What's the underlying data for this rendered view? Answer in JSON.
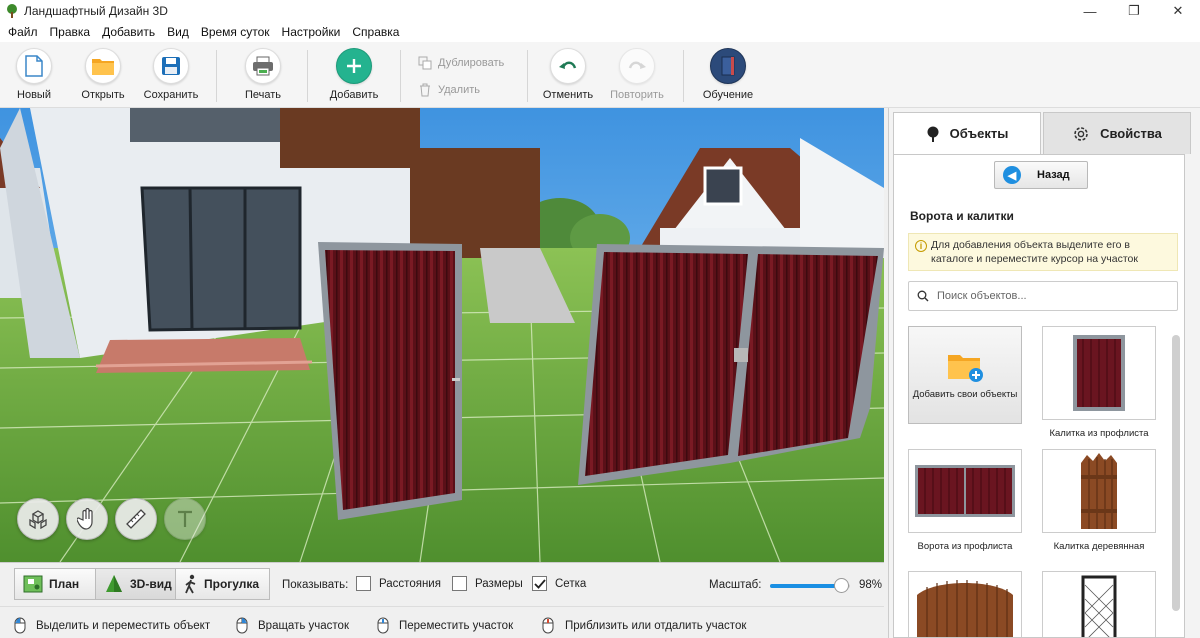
{
  "window": {
    "title": "Ландшафтный Дизайн 3D",
    "minimize": "—",
    "maximize": "❐",
    "close": "✕"
  },
  "menu": [
    "Файл",
    "Правка",
    "Добавить",
    "Вид",
    "Время суток",
    "Настройки",
    "Справка"
  ],
  "toolbar": {
    "new": "Новый",
    "open": "Открыть",
    "save": "Сохранить",
    "print": "Печать",
    "add": "Добавить",
    "duplicate": "Дублировать",
    "delete": "Удалить",
    "undo": "Отменить",
    "redo": "Повторить",
    "tutorial": "Обучение"
  },
  "panel": {
    "tabs": {
      "objects": "Объекты",
      "properties": "Свойства"
    },
    "back": "Назад",
    "section_title": "Ворота и калитки",
    "hint": "Для добавления объекта выделите его в каталоге и переместите курсор на участок",
    "search_placeholder": "Поиск объектов...",
    "add_own": "Добавить свои объекты",
    "catalog": [
      "Калитка из профлиста",
      "Ворота из профлиста",
      "Калитка деревянная"
    ]
  },
  "viewbar": {
    "plan": "План",
    "view3d": "3D-вид",
    "walk": "Прогулка",
    "show_label": "Показывать:",
    "distances": "Расстояния",
    "sizes": "Размеры",
    "grid": "Сетка",
    "distances_checked": false,
    "sizes_checked": false,
    "grid_checked": true,
    "scale_label": "Масштаб:",
    "scale_value": "98%",
    "scale_fraction": 0.98
  },
  "statusbar": [
    "Выделить и переместить объект",
    "Вращать участок",
    "Переместить участок",
    "Приблизить или отдалить участок"
  ],
  "colors": {
    "accent": "#1a8fe3",
    "add_button": "#24b38f",
    "profile_sheet": "#5a1018",
    "grass": "#63a83c",
    "sky": "#5aa8e8"
  }
}
